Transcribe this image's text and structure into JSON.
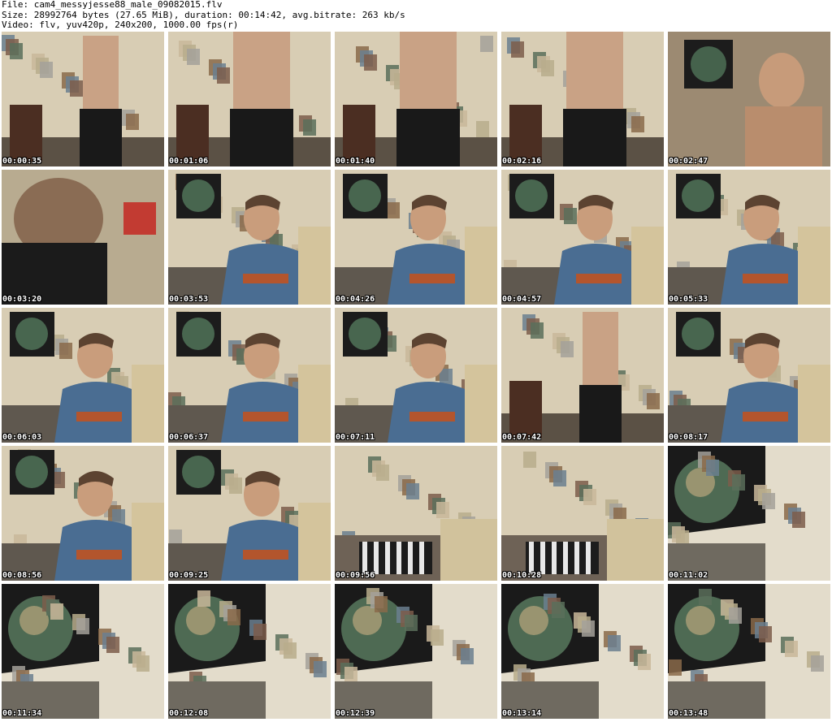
{
  "header": {
    "file_line": "File: cam4_messyjesse88_male_09082015.flv",
    "size_line": "Size: 28992764 bytes (27.65 MiB), duration: 00:14:42, avg.bitrate: 263 kb/s",
    "video_line": "Video: flv, yuv420p, 240x200, 1000.00 fps(r)"
  },
  "thumbnails": [
    {
      "time": "00:00:35",
      "scene": "standing-room"
    },
    {
      "time": "00:01:06",
      "scene": "standing-closeup"
    },
    {
      "time": "00:01:40",
      "scene": "standing-closeup"
    },
    {
      "time": "00:02:16",
      "scene": "standing-closeup"
    },
    {
      "time": "00:02:47",
      "scene": "face-closeup"
    },
    {
      "time": "00:03:20",
      "scene": "blur-motion"
    },
    {
      "time": "00:03:53",
      "scene": "seated-person"
    },
    {
      "time": "00:04:26",
      "scene": "seated-person"
    },
    {
      "time": "00:04:57",
      "scene": "seated-person"
    },
    {
      "time": "00:05:33",
      "scene": "seated-person"
    },
    {
      "time": "00:06:03",
      "scene": "seated-person"
    },
    {
      "time": "00:06:37",
      "scene": "seated-person"
    },
    {
      "time": "00:07:11",
      "scene": "seated-person"
    },
    {
      "time": "00:07:42",
      "scene": "standing-room"
    },
    {
      "time": "00:08:17",
      "scene": "seated-person"
    },
    {
      "time": "00:08:56",
      "scene": "seated-person"
    },
    {
      "time": "00:09:25",
      "scene": "seated-person"
    },
    {
      "time": "00:09:56",
      "scene": "empty-room"
    },
    {
      "time": "00:10:28",
      "scene": "empty-room"
    },
    {
      "time": "00:11:02",
      "scene": "wall-poster"
    },
    {
      "time": "00:11:34",
      "scene": "wall-poster"
    },
    {
      "time": "00:12:08",
      "scene": "wall-poster"
    },
    {
      "time": "00:12:39",
      "scene": "wall-poster"
    },
    {
      "time": "00:13:14",
      "scene": "wall-poster"
    },
    {
      "time": "00:13:48",
      "scene": "wall-poster"
    }
  ],
  "colors": {
    "background": "#ffffff",
    "header_text": "#000000",
    "timestamp_text": "#ffffff",
    "timestamp_outline": "#000000"
  }
}
